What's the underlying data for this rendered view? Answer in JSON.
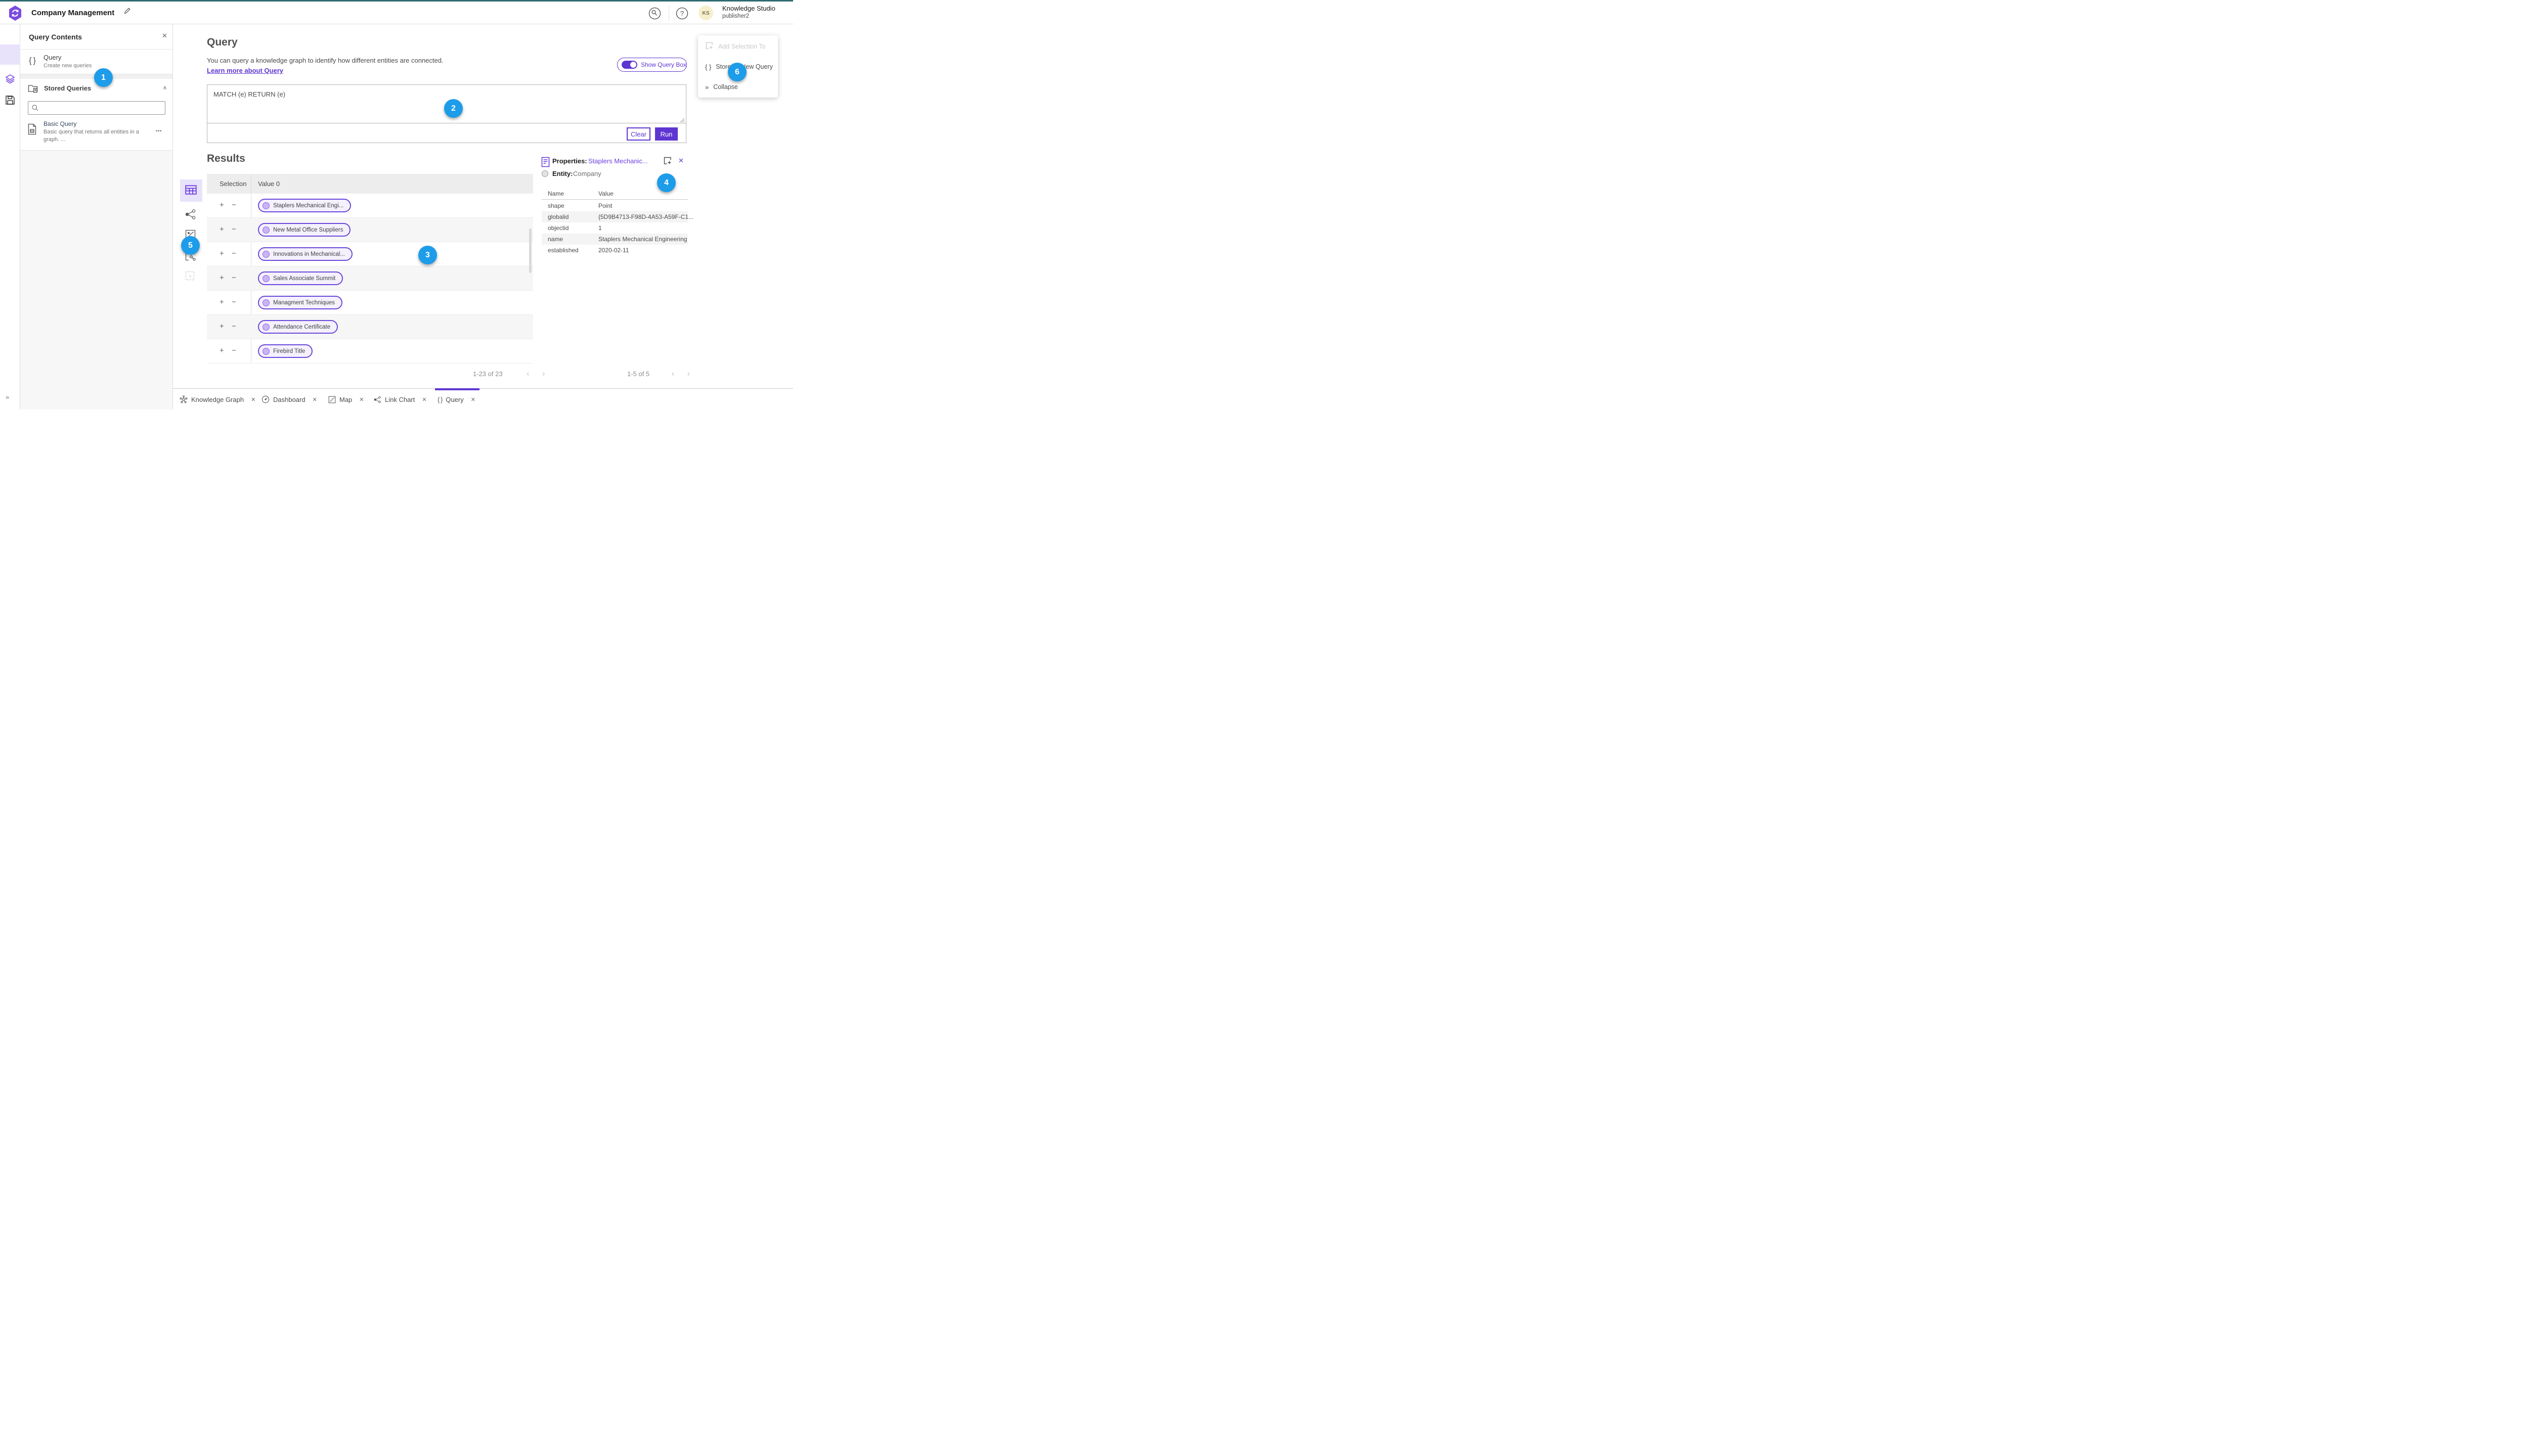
{
  "colors": {
    "accent": "#5e35d1",
    "logo_purple": "#7a4be0",
    "top_strip_teal": "#2f6b72",
    "callout_blue": "#1d9ce9",
    "selected_tile_bg": "#e9e2fb",
    "pill_bg": "#f4f1fd",
    "pill_border": "#6b48dd"
  },
  "icons": {
    "close": "✕",
    "ellipsis": "•••",
    "chevron_left": "‹",
    "chevron_right": "›",
    "collapse_chevrons": "»",
    "caret_up": "∧",
    "braces": "{ }",
    "plus": "+",
    "minus": "−"
  },
  "header": {
    "app_title": "Company Management",
    "user_name": "Knowledge Studio",
    "user_role": "publisher2",
    "avatar_initials": "KS"
  },
  "left_panel": {
    "title": "Query Contents",
    "query_item": {
      "label": "Query",
      "sublabel": "Create new queries"
    },
    "stored_queries": {
      "title": "Stored Queries",
      "item_title": "Basic Query",
      "item_description": "Basic query that returns all entities in a graph. ..."
    }
  },
  "query_section": {
    "title": "Query",
    "description": "You can query a knowledge graph to identify how different entities are connected.",
    "learn_more": "Learn more about Query",
    "toggle_label": "Show Query Box",
    "query_text": "MATCH (e) RETURN (e)",
    "clear_label": "Clear",
    "run_label": "Run"
  },
  "results": {
    "title": "Results",
    "columns": [
      "Selection",
      "Value 0"
    ],
    "rows": [
      "Staplers Mechanical Engi...",
      "New Metal Office Suppliers",
      "Innovations in Mechanical...",
      "Sales Associate Summit",
      "Managment Techniques",
      "Attendance Certificate",
      "Firebird Title"
    ],
    "pagination": "1-23 of 23"
  },
  "properties_panel": {
    "title": "Properties:",
    "entity_link": "Staplers Mechanic...",
    "entity_label": "Entity:",
    "entity_type": "Company",
    "columns": [
      "Name",
      "Value"
    ],
    "rows": [
      {
        "name": "shape",
        "value": "Point"
      },
      {
        "name": "globalid",
        "value": "{5D9B4713-F98D-4A53-A59F-C1..."
      },
      {
        "name": "objectid",
        "value": "1"
      },
      {
        "name": "name",
        "value": "Staplers Mechanical Engineering"
      },
      {
        "name": "established",
        "value": "2020-02-11"
      }
    ],
    "pagination": "1-5 of 5"
  },
  "context_menu": {
    "items": [
      {
        "label": "Add Selection To"
      },
      {
        "label": "Store as New Query"
      },
      {
        "label": "Collapse"
      }
    ]
  },
  "tabs": {
    "items": [
      {
        "label": "Knowledge Graph"
      },
      {
        "label": "Dashboard"
      },
      {
        "label": "Map"
      },
      {
        "label": "Link Chart"
      },
      {
        "label": "Query",
        "active": true
      }
    ]
  },
  "callouts": [
    "1",
    "2",
    "3",
    "4",
    "5",
    "6"
  ]
}
